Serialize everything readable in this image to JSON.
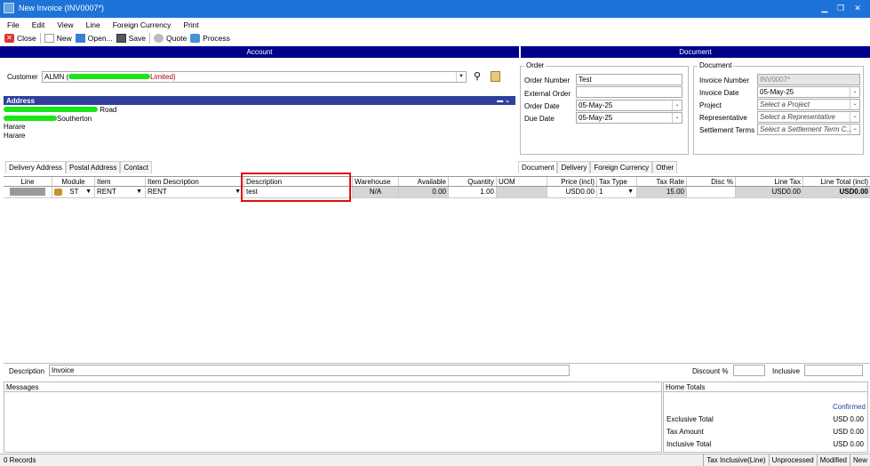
{
  "window": {
    "title": "New Invoice (INV0007*)",
    "min": "▁",
    "restore": "❐",
    "close": "✕"
  },
  "menu": [
    "File",
    "Edit",
    "View",
    "Line",
    "Foreign Currency",
    "Print"
  ],
  "toolbar": {
    "close": "Close",
    "new": "New",
    "open": "Open...",
    "save": "Save",
    "quote": "Quote",
    "process": "Process"
  },
  "sections": {
    "account": "Account",
    "document": "Document"
  },
  "customer": {
    "label": "Customer",
    "value_start": "ALMN (",
    "value_end": "Limited)"
  },
  "address": {
    "title": "Address",
    "lines": [
      "Road",
      "Southerton",
      "Harare",
      "Harare"
    ]
  },
  "order": {
    "title": "Order",
    "order_number_label": "Order Number",
    "order_number": "Test",
    "external_order_label": "External Order",
    "external_order": "",
    "order_date_label": "Order Date",
    "order_date": "05-May-25",
    "due_date_label": "Due Date",
    "due_date": "05-May-25"
  },
  "document": {
    "title": "Document",
    "invoice_number_label": "Invoice Number",
    "invoice_number": "INV0007*",
    "invoice_date_label": "Invoice Date",
    "invoice_date": "05-May-25",
    "project_label": "Project",
    "project_placeholder": "Select a Project",
    "rep_label": "Representative",
    "rep_placeholder": "Select a Representative",
    "terms_label": "Settlement Terms",
    "terms_placeholder": "Select a Settlement Term C..."
  },
  "left_tabs": [
    "Delivery Address",
    "Postal Address",
    "Contact"
  ],
  "right_tabs": [
    "Document",
    "Delivery",
    "Foreign Currency",
    "Other"
  ],
  "grid": {
    "headers": [
      "Line",
      "Module",
      "Item",
      "Item Description",
      "Description",
      "Warehouse",
      "Available",
      "Quantity",
      "UOM",
      "Price (incl)",
      "Tax Type",
      "Tax Rate",
      "Disc %",
      "Line Tax",
      "Line Total (incl)"
    ],
    "row": {
      "module": "ST",
      "item": "RENT",
      "item_desc": "RENT",
      "description": "test",
      "warehouse": "N/A",
      "available": "0.00",
      "quantity": "1.00",
      "uom": "",
      "price": "USD0.00",
      "tax_type": "1",
      "tax_rate": "15.00",
      "disc": "",
      "line_tax": "USD0.00",
      "line_total": "USD0.00"
    }
  },
  "footer": {
    "description_label": "Description",
    "description_value": "Invoice",
    "discount_label": "Discount %",
    "inclusive_label": "Inclusive",
    "messages_label": "Messages",
    "home_totals_label": "Home Totals",
    "status": "Confirmed",
    "excl_label": "Exclusive Total",
    "excl_value": "USD 0.00",
    "tax_label": "Tax Amount",
    "tax_value": "USD 0.00",
    "incl_label": "Inclusive Total",
    "incl_value": "USD 0.00"
  },
  "statusbar": {
    "records": "0 Records",
    "cells": [
      "Tax Inclusive(Line)",
      "Unprocessed",
      "Modified",
      "New"
    ]
  },
  "colors": {
    "titlebar": "#1e73d8",
    "section": "#00008b",
    "address_bar": "#2f3f9c",
    "highlight": "#e01010",
    "confirmed": "#1f3f9f"
  },
  "icons": [
    "app-icon",
    "close-icon",
    "new-icon",
    "open-icon",
    "save-icon",
    "quote-icon",
    "process-icon",
    "search-icon",
    "customer-card-icon",
    "module-icon"
  ]
}
